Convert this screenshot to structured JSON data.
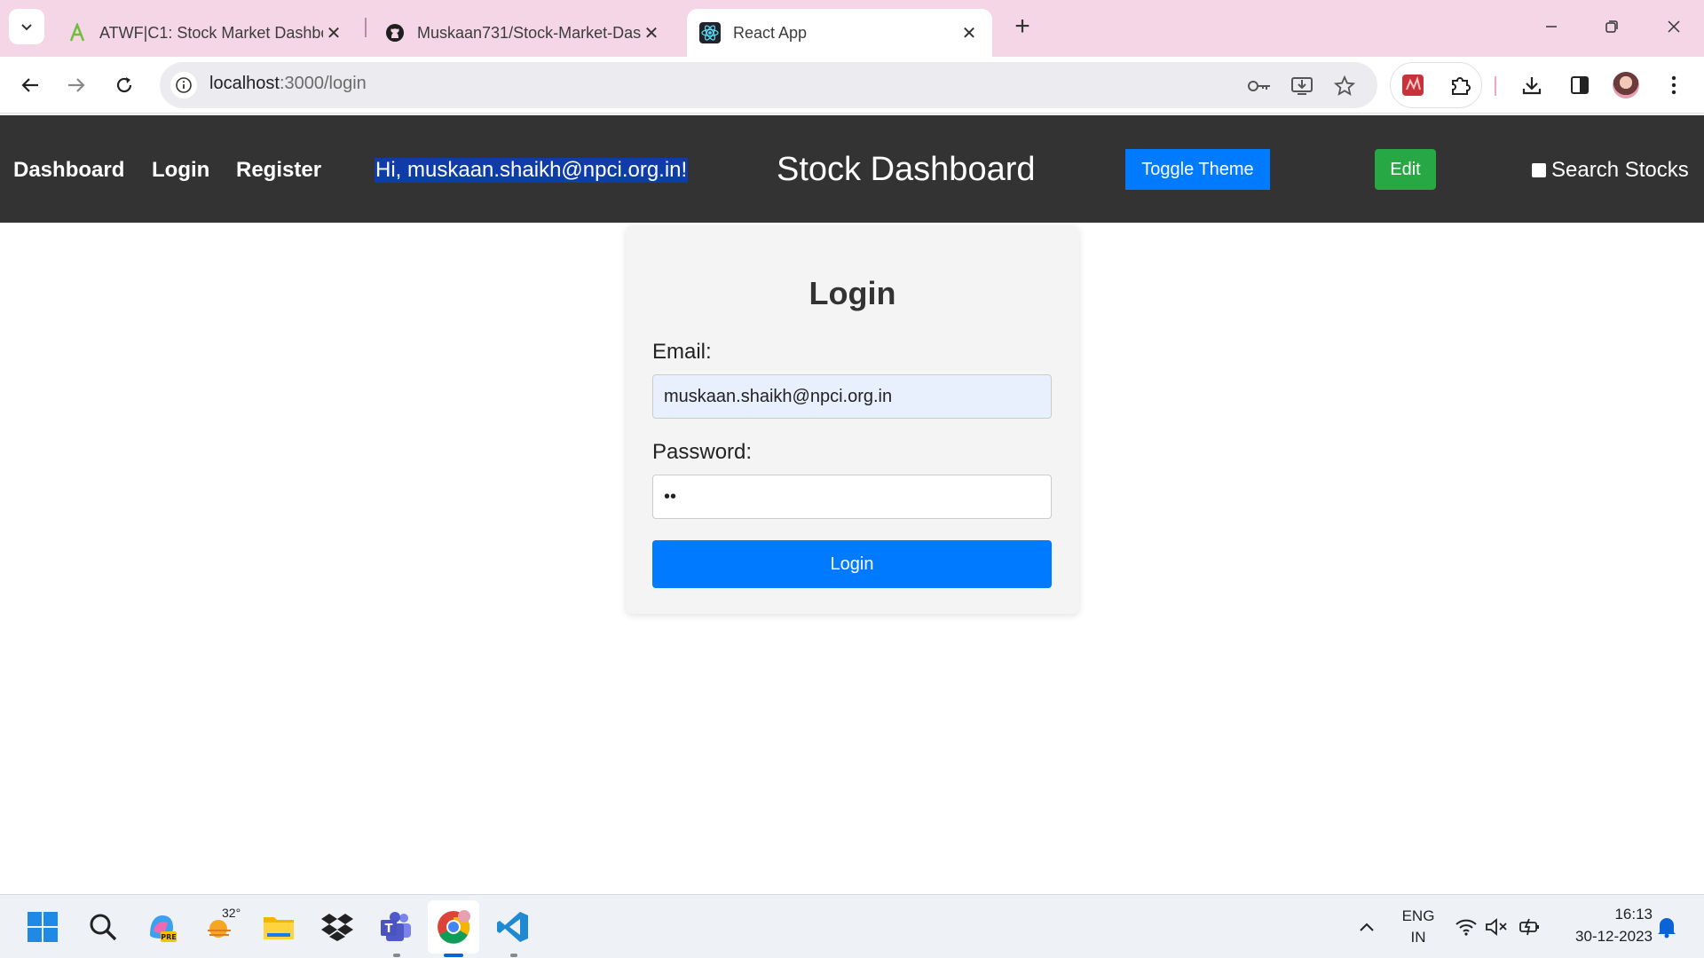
{
  "browser": {
    "tabs": [
      {
        "title": "ATWF|C1: Stock Market Dashbo",
        "icon": "atwf-icon",
        "active": false
      },
      {
        "title": "Muskaan731/Stock-Market-Das",
        "icon": "github-icon",
        "active": false
      },
      {
        "title": "React App",
        "icon": "react-icon",
        "active": true
      }
    ],
    "url_host": "localhost",
    "url_path": ":3000/login"
  },
  "nav": {
    "links": [
      "Dashboard",
      "Login",
      "Register"
    ],
    "greeting": "Hi, muskaan.shaikh@npci.org.in!",
    "brand": "Stock Dashboard",
    "toggle_theme_label": "Toggle Theme",
    "edit_label": "Edit",
    "search_label": "Search Stocks",
    "search_checked": false
  },
  "login": {
    "heading": "Login",
    "email_label": "Email:",
    "email_value": "muskaan.shaikh@npci.org.in",
    "password_label": "Password:",
    "password_value": "••",
    "submit_label": "Login"
  },
  "taskbar": {
    "weather_temp": "32°",
    "lang_line1": "ENG",
    "lang_line2": "IN",
    "time": "16:13",
    "date": "30-12-2023"
  },
  "colors": {
    "tabstrip": "#f5d6e6",
    "nav_bg": "#333333",
    "primary": "#007bff",
    "success": "#28a745",
    "card_bg": "#f4f4f4"
  }
}
